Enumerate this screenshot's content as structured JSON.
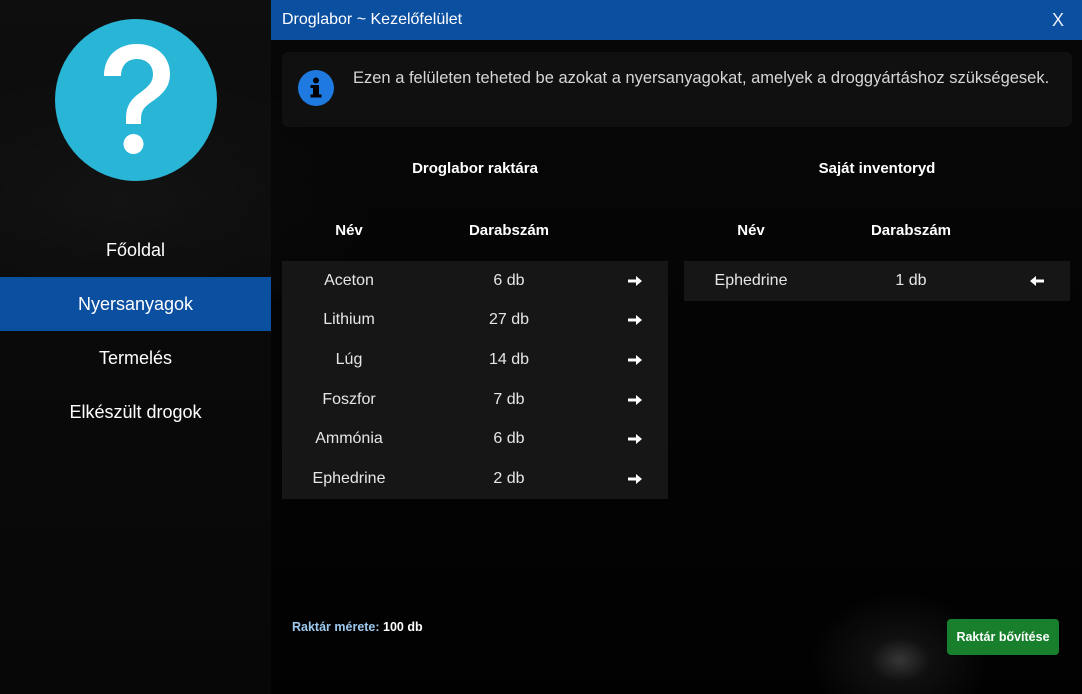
{
  "window": {
    "title": "Droglabor ~ Kezelőfelület",
    "close_label": "X"
  },
  "sidebar": {
    "items": [
      {
        "label": "Főoldal"
      },
      {
        "label": "Nyersanyagok"
      },
      {
        "label": "Termelés"
      },
      {
        "label": "Elkészült drogok"
      }
    ],
    "active_index": 1,
    "avatar_icon": "question-mark-icon"
  },
  "info": {
    "icon": "info-icon",
    "text": "Ezen a felületen teheted be azokat a nyersanyagokat, amelyek a droggyártáshoz szükségesek."
  },
  "lab_storage": {
    "title": "Droglabor raktára",
    "col_name": "Név",
    "col_qty": "Darabszám",
    "rows": [
      {
        "name": "Aceton",
        "qty": "6 db"
      },
      {
        "name": "Lithium",
        "qty": "27 db"
      },
      {
        "name": "Lúg",
        "qty": "14 db"
      },
      {
        "name": "Foszfor",
        "qty": "7 db"
      },
      {
        "name": "Ammónia",
        "qty": "6 db"
      },
      {
        "name": "Ephedrine",
        "qty": "2 db"
      }
    ]
  },
  "inventory": {
    "title": "Saját inventoryd",
    "col_name": "Név",
    "col_qty": "Darabszám",
    "rows": [
      {
        "name": "Ephedrine",
        "qty": "1 db"
      }
    ]
  },
  "footer": {
    "storage_label": "Raktár mérete:",
    "storage_value": "100 db",
    "expand_button": "Raktár bővítése"
  },
  "colors": {
    "accent": "#0b4fa0",
    "avatar": "#29b6d6",
    "info_icon": "#1e7ae0",
    "button_green": "#18802c"
  }
}
